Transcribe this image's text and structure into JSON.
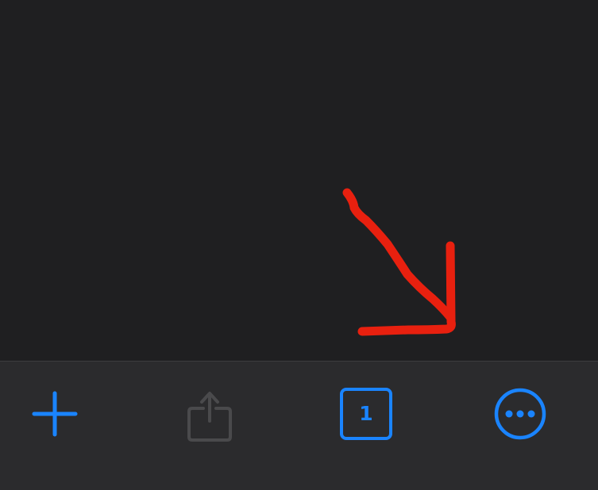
{
  "colors": {
    "background": "#1f1f21",
    "toolbar_background": "#2b2b2d",
    "toolbar_border": "#3d3d3f",
    "accent": "#1a84ff",
    "disabled": "#4a4a4c",
    "annotation_arrow": "#e8200f"
  },
  "toolbar": {
    "new_tab": {
      "icon": "plus-icon",
      "enabled": true
    },
    "share": {
      "icon": "share-icon",
      "enabled": false
    },
    "tabs": {
      "icon": "tabs-icon",
      "count": "1",
      "enabled": true
    },
    "more": {
      "icon": "ellipsis-circle-icon",
      "enabled": true
    }
  },
  "annotation": {
    "type": "hand-drawn-arrow",
    "points_to": "more-button"
  }
}
